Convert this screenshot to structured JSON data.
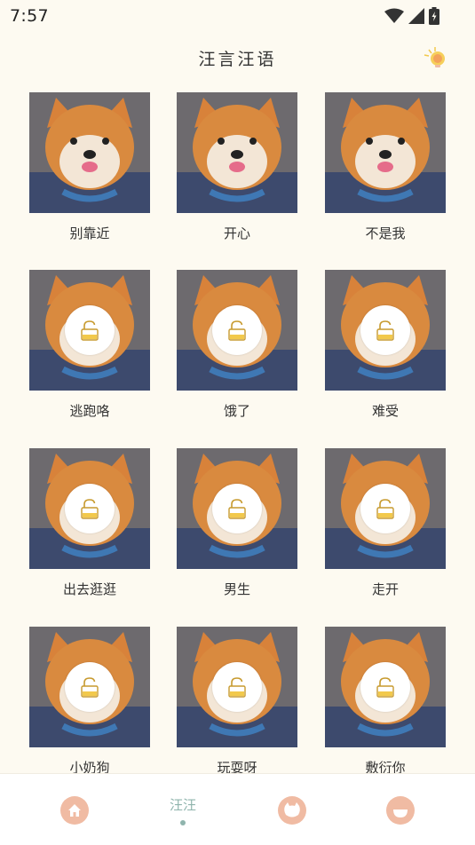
{
  "status_bar": {
    "time": "7:57",
    "icons": [
      "wifi-icon",
      "signal-icon",
      "battery-icon"
    ]
  },
  "header": {
    "title": "汪言汪语",
    "action_icon": "lightbulb-icon"
  },
  "cards": [
    {
      "label": "别靠近",
      "locked": false
    },
    {
      "label": "开心",
      "locked": false
    },
    {
      "label": "不是我",
      "locked": false
    },
    {
      "label": "逃跑咯",
      "locked": true
    },
    {
      "label": "饿了",
      "locked": true
    },
    {
      "label": "难受",
      "locked": true
    },
    {
      "label": "出去逛逛",
      "locked": true
    },
    {
      "label": "男生",
      "locked": true
    },
    {
      "label": "走开",
      "locked": true
    },
    {
      "label": "小奶狗",
      "locked": true
    },
    {
      "label": "玩耍呀",
      "locked": true
    },
    {
      "label": "敷衍你",
      "locked": true
    }
  ],
  "bottom_nav": {
    "items": [
      {
        "icon": "home-icon",
        "label": ""
      },
      {
        "icon": "",
        "label": "汪汪",
        "active": true
      },
      {
        "icon": "cat-face-icon",
        "label": ""
      },
      {
        "icon": "happy-face-icon",
        "label": ""
      }
    ]
  },
  "colors": {
    "background": "#fdfaf1",
    "accent_teal": "#8fb4ad",
    "nav_icon": "#f0bba3",
    "lock_yellow": "#f2c94c"
  }
}
